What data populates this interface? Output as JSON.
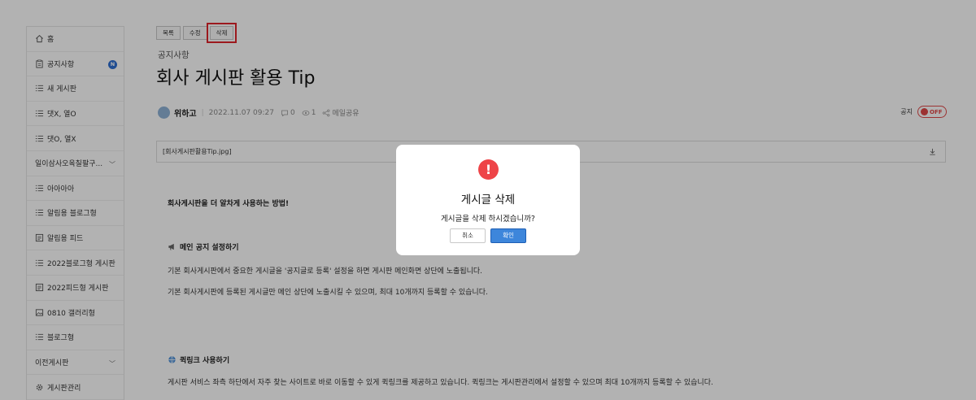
{
  "sidebar": {
    "items": [
      {
        "label": "홈",
        "icon": "home-icon"
      },
      {
        "label": "공지사항",
        "icon": "clipboard-icon",
        "badge": "N"
      },
      {
        "label": "새 게시판",
        "icon": "list-icon"
      },
      {
        "label": "댓X, 열O",
        "icon": "list-icon"
      },
      {
        "label": "댓O, 열X",
        "icon": "list-icon"
      },
      {
        "label": "일이삼사오육칠팔구...",
        "icon": "",
        "expandable": true
      },
      {
        "label": "아아아아",
        "icon": "list-icon"
      },
      {
        "label": "알림용 블로그형",
        "icon": "list-icon"
      },
      {
        "label": "알림용 피드",
        "icon": "feed-icon"
      },
      {
        "label": "2022블로그형 게시판",
        "icon": "list-icon"
      },
      {
        "label": "2022피드형 게시판",
        "icon": "feed-icon"
      },
      {
        "label": "0810 갤러리형",
        "icon": "image-icon"
      },
      {
        "label": "블로그형",
        "icon": "list-icon"
      },
      {
        "label": "이전게시판",
        "icon": "",
        "expandable": true
      },
      {
        "label": "게시판관리",
        "icon": "gear-icon"
      }
    ]
  },
  "toolbar": {
    "list_label": "목록",
    "edit_label": "수정",
    "delete_label": "삭제"
  },
  "post": {
    "board": "공지사항",
    "title": "회사 게시판 활용 Tip",
    "author": "위하고",
    "date": "2022.11.07 09:27",
    "comments": "0",
    "views": "1",
    "share": "메일공유",
    "notice_label": "공지",
    "notice_toggle": "OFF",
    "attachment": "[회사게시판활용Tip.jpg]",
    "body": {
      "intro": "회사게시판을 더 알차게 사용하는 방법!",
      "section1_title": "메인 공지 설정하기",
      "section1_line1": "기본 회사게시판에서 중요한 게시글을 '공지글로 등록' 설정을 하면 게시판 메인화면 상단에 노출됩니다.",
      "section1_line2": "기본 회사게시판에 등록된 게시글만 메인 상단에 노출시킬 수 있으며, 최대 10개까지 등록할 수 있습니다.",
      "section2_title": "퀵링크 사용하기",
      "section2_line1": "게시판 서비스 좌측 하단에서 자주 찾는 사이트로 바로 이동할 수 있게 퀵링크를 제공하고 있습니다. 퀵링크는 게시판관리에서 설정할 수 있으며 최대 10개까지 등록할 수 있습니다."
    }
  },
  "dialog": {
    "icon": "!",
    "title": "게시글 삭제",
    "message": "게시글을 삭제 하시겠습니까?",
    "cancel_label": "취소",
    "confirm_label": "확인"
  },
  "colors": {
    "accent": "#3d86db",
    "danger": "#ee4448",
    "badge": "#2e6fd1"
  }
}
